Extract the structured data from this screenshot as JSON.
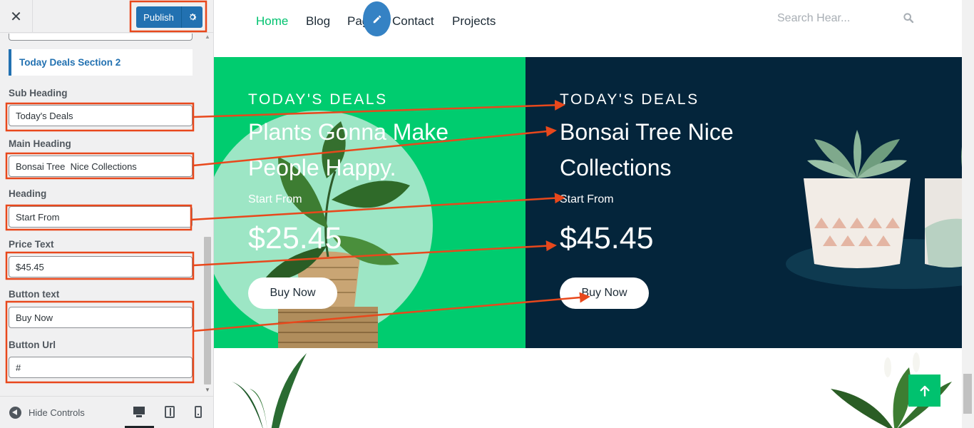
{
  "sidebar": {
    "close_icon": "close-icon",
    "publish_label": "Publish",
    "settings_icon": "gear-icon",
    "section_title": "Today Deals Section 2",
    "fields": {
      "sub_heading": {
        "label": "Sub Heading",
        "value": "Today's Deals"
      },
      "main_heading": {
        "label": "Main Heading",
        "value": "Bonsai Tree  Nice Collections"
      },
      "heading": {
        "label": "Heading",
        "value": "Start From"
      },
      "price_text": {
        "label": "Price Text",
        "value": "$45.45"
      },
      "button_text": {
        "label": "Button text",
        "value": "Buy Now"
      },
      "button_url": {
        "label": "Button Url",
        "value": "#"
      }
    },
    "footer": {
      "hide_controls": "Hide Controls"
    }
  },
  "preview": {
    "nav": {
      "home": "Home",
      "blog": "Blog",
      "pages": "Pag",
      "contact": "Contact",
      "projects": "Projects"
    },
    "search": {
      "placeholder": "Search Hear..."
    },
    "deal_left": {
      "sub_heading": "TODAY'S DEALS",
      "main_heading_line1": "Plants Gonna Make",
      "main_heading_line2": "People Happy.",
      "start_from": "Start From",
      "price": "$25.45",
      "button": "Buy Now"
    },
    "deal_right": {
      "sub_heading": "TODAY'S DEALS",
      "main_heading_line1": "Bonsai Tree Nice",
      "main_heading_line2": "Collections",
      "start_from": "Start From",
      "price": "$45.45",
      "button": "Buy Now"
    }
  },
  "colors": {
    "highlight": "#e8481c",
    "accent_green": "#00cc6f",
    "dark_navy": "#04253b",
    "wp_blue": "#2271b1"
  }
}
